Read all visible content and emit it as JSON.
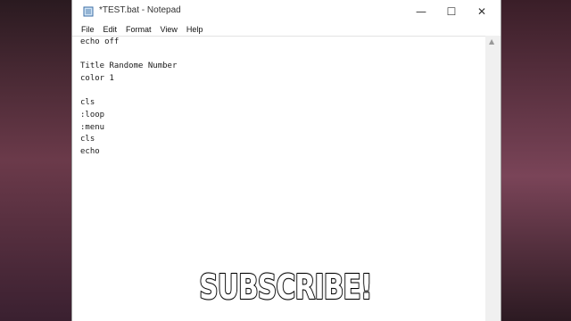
{
  "window": {
    "title": "*TEST.bat - Notepad",
    "minimize_glyph": "—",
    "maximize_glyph": "☐",
    "close_glyph": "✕"
  },
  "menu": {
    "items": [
      "File",
      "Edit",
      "Format",
      "View",
      "Help"
    ]
  },
  "editor": {
    "lines": [
      "echo off",
      "",
      "Title Randome Number",
      "color 1",
      "",
      "cls",
      ":loop",
      ":menu",
      "cls",
      "echo"
    ]
  },
  "scrollbar": {
    "up_glyph": "▲"
  },
  "overlay": {
    "caption": "SUBSCRIBE!"
  },
  "colors": {
    "window_bg": "#ffffff",
    "text": "#1a1a1a",
    "caption_fill": "#ffffff",
    "caption_stroke": "#000000"
  }
}
